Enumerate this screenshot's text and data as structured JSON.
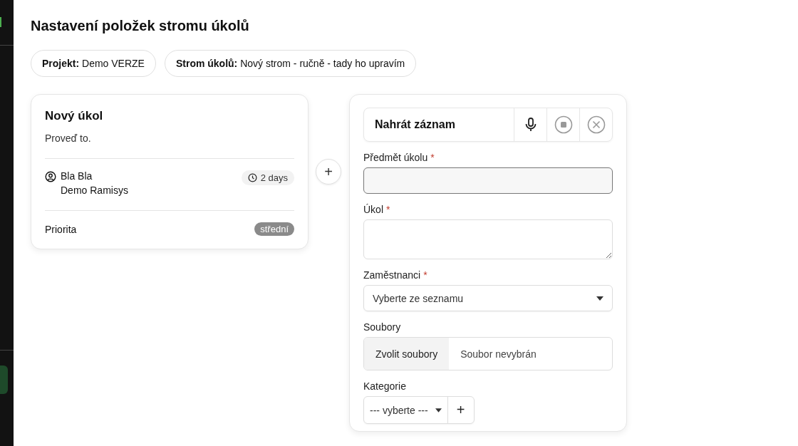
{
  "page_title": "Nastavení položek stromu úkolů",
  "chips": [
    {
      "label": "Projekt:",
      "value": "Demo VERZE"
    },
    {
      "label": "Strom úkolů:",
      "value": "Nový strom - ručně - tady ho upravím"
    }
  ],
  "task_card": {
    "title": "Nový úkol",
    "description": "Proveď to.",
    "assignee": "Bla Bla",
    "company": "Demo Ramisys",
    "duration": "2 days",
    "priority_label": "Priorita",
    "priority": "střední"
  },
  "add_button": "+",
  "form": {
    "recorder": {
      "label": "Nahrát záznam"
    },
    "fields": [
      {
        "kind": "text",
        "label": "Předmět úkolu",
        "required_mark": "*",
        "focused": true
      },
      {
        "kind": "textarea",
        "label": "Úkol",
        "required_mark": "*",
        "focused": false
      },
      {
        "kind": "select",
        "label": "Zaměstnanci",
        "required_mark": "*",
        "placeholder": "Vyberte ze seznamu"
      },
      {
        "kind": "file",
        "label": "Soubory",
        "button": "Zvolit soubory",
        "status": "Soubor nevybrán"
      },
      {
        "kind": "category",
        "label": "Kategorie",
        "placeholder": "--- vyberte ---",
        "add": "+"
      }
    ]
  }
}
